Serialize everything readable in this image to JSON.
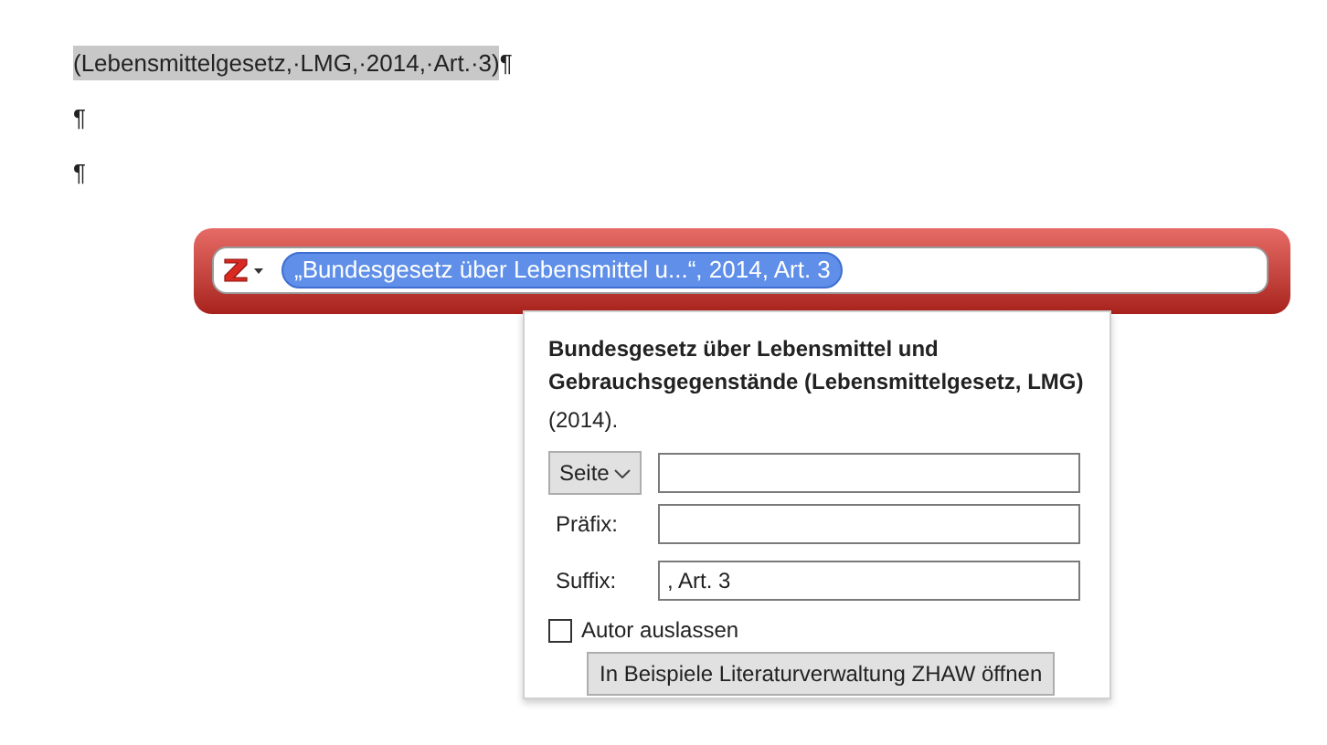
{
  "document": {
    "paragraphs": [
      {
        "citation": "(Lebensmittelgesetz,·LMG,·2014,·Art.·3)",
        "highlighted": true,
        "pilcrow": "¶"
      },
      {
        "pilcrow": "¶"
      },
      {
        "pilcrow": "¶"
      }
    ]
  },
  "quick_format": {
    "citation_bubble": "„Bundesgesetz über Lebensmittel u...“, 2014, Art. 3",
    "selected": true
  },
  "popup": {
    "title": "Bundesgesetz über Lebensmittel und Gebrauchsgegenstände (Lebensmittelgesetz, LMG)",
    "year": "(2014).",
    "locator": {
      "label": "Seite"
    },
    "fields": [
      {
        "label": "Präfix:"
      },
      {
        "label": "Suffix:",
        "value": ", Art. 3"
      }
    ],
    "omit_author": {
      "label": "Autor auslassen",
      "checked": false
    },
    "open_button": "In Beispiele Literaturverwaltung ZHAW öffnen"
  }
}
